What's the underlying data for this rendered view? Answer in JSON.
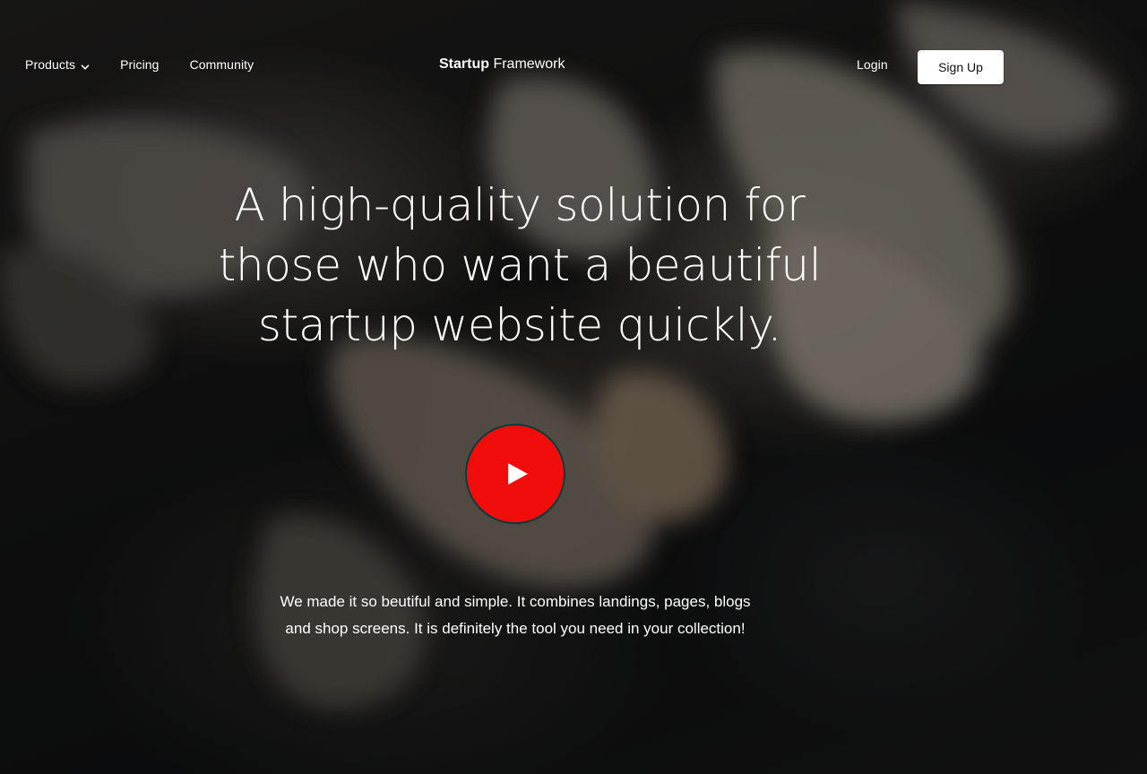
{
  "nav": {
    "products_label": "Products",
    "pricing_label": "Pricing",
    "community_label": "Community",
    "login_label": "Login",
    "signup_label": "Sign Up"
  },
  "brand": {
    "bold": "Startup",
    "light": " Framework"
  },
  "hero": {
    "headline": "A high-quality solution for those who want a beautiful startup website quickly.",
    "description": "We made it so beutiful and simple. It combines landings, pages, blogs and shop screens. It is definitely the tool you need in your collection!",
    "play_icon": "play-icon",
    "play_color": "#f20d0d"
  },
  "icons": {
    "products_dropdown": "chevron-down-icon"
  }
}
